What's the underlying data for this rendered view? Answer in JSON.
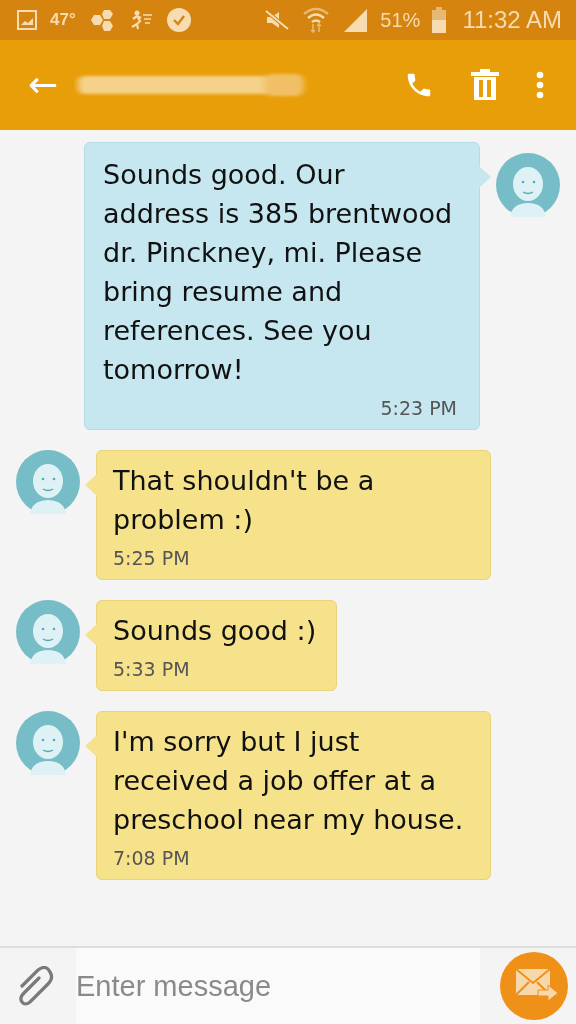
{
  "status_bar": {
    "temperature": "47°",
    "battery_percent": "51%",
    "time": "11:32 AM"
  },
  "header": {
    "back": "←"
  },
  "messages": [
    {
      "kind": "sent",
      "text": "Sounds good. Our address is 385 brentwood dr. Pinckney, mi. Please bring resume and references. See you tomorrow!",
      "time": "5:23 PM"
    },
    {
      "kind": "received",
      "text": "That shouldn't be a problem :)",
      "time": "5:25 PM"
    },
    {
      "kind": "received",
      "text": "Sounds good :)",
      "time": "5:33 PM"
    },
    {
      "kind": "received",
      "text": "I'm sorry but I just received a job offer at a preschool near my house.",
      "time": "7:08 PM"
    }
  ],
  "composer": {
    "placeholder": "Enter message"
  }
}
